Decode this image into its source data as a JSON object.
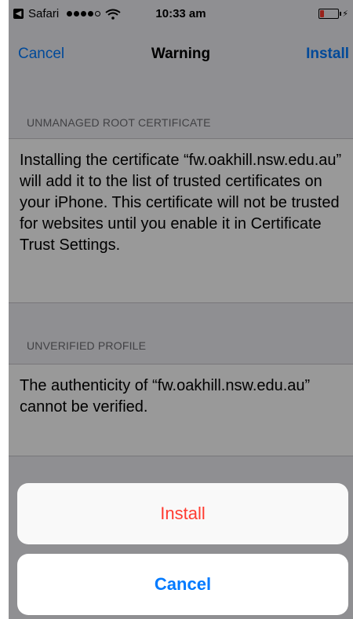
{
  "status_bar": {
    "app": "Safari",
    "time": "10:33 am"
  },
  "nav": {
    "left": "Cancel",
    "title": "Warning",
    "right": "Install"
  },
  "sections": [
    {
      "header": "UNMANAGED ROOT CERTIFICATE",
      "text": "Installing the certificate “fw.oakhill.nsw.edu.au” will add it to the list of trusted certificates on your iPhone. This certificate will not be trusted for websites until you enable it in Certificate Trust Settings."
    },
    {
      "header": "UNVERIFIED PROFILE",
      "text": "The authenticity of “fw.oakhill.nsw.edu.au” cannot be verified."
    }
  ],
  "action_sheet": {
    "install": "Install",
    "cancel": "Cancel"
  },
  "colors": {
    "ios_blue": "#007aff",
    "destructive_red": "#ff3b30",
    "group_background": "#efeff4"
  },
  "icons": [
    "back-to-app-icon",
    "signal-strength-icon",
    "wifi-icon",
    "battery-icon",
    "charging-bolt-icon"
  ]
}
